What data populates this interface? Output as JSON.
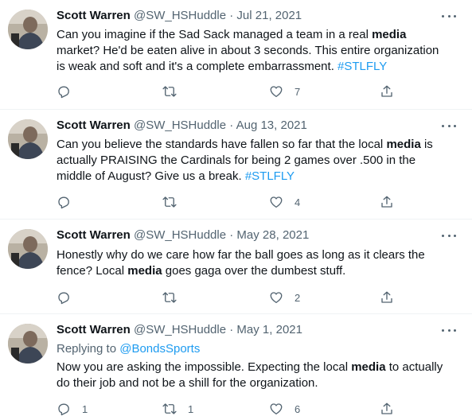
{
  "user": {
    "name": "Scott Warren",
    "handle": "@SW_HSHuddle"
  },
  "tweets": [
    {
      "date": "Jul 21, 2021",
      "segments": [
        {
          "t": "Can you imagine if the Sad Sack managed a team in a real "
        },
        {
          "t": "media",
          "style": "bold"
        },
        {
          "t": " market? He'd be eaten alive in about 3 seconds.  This entire organization is weak and soft and it's a complete embarrassment.  "
        },
        {
          "t": "#STLFLY",
          "style": "tag"
        }
      ],
      "replies": "",
      "retweets": "",
      "likes": "7"
    },
    {
      "date": "Aug 13, 2021",
      "segments": [
        {
          "t": "Can you believe the standards have fallen so far that the local "
        },
        {
          "t": "media",
          "style": "bold"
        },
        {
          "t": " is actually PRAISING the Cardinals for being 2 games over .500 in the middle of August?  Give us a break.  "
        },
        {
          "t": "#STLFLY",
          "style": "tag"
        }
      ],
      "replies": "",
      "retweets": "",
      "likes": "4"
    },
    {
      "date": "May 28, 2021",
      "segments": [
        {
          "t": "Honestly why do we care how far the ball goes as long as it clears the fence?  Local "
        },
        {
          "t": "media",
          "style": "bold"
        },
        {
          "t": " goes gaga over the dumbest stuff."
        }
      ],
      "replies": "",
      "retweets": "",
      "likes": "2"
    },
    {
      "date": "May 1, 2021",
      "reply_to_label": "Replying to ",
      "reply_to": "@BondsSports",
      "segments": [
        {
          "t": "Now you are asking the impossible.  Expecting the local "
        },
        {
          "t": "media",
          "style": "bold"
        },
        {
          "t": " to actually do their job and not be a shill for the organization."
        }
      ],
      "replies": "1",
      "retweets": "1",
      "likes": "6"
    }
  ],
  "icons": {
    "reply": "reply-icon",
    "retweet": "retweet-icon",
    "like": "heart-icon",
    "share": "share-icon",
    "more": "more-icon"
  },
  "colors": {
    "link": "#1d9bf0",
    "secondary": "#536471",
    "text": "#0f1419",
    "divider": "#eff3f4"
  }
}
